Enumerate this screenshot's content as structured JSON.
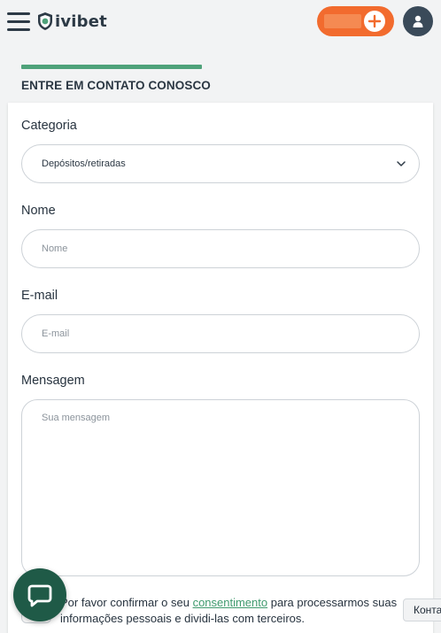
{
  "header": {
    "brand": "ivibet",
    "menu_icon": "hamburger-menu-icon",
    "deposit_icon": "plus-icon",
    "account_icon": "user-icon",
    "accent_color": "#f26b2e"
  },
  "page": {
    "title": "ENTRE EM CONTATO CONOSCO",
    "title_accent_color": "#4fa27a"
  },
  "form": {
    "category": {
      "label": "Categoria",
      "value": "Depósitos/retiradas"
    },
    "name": {
      "label": "Nome",
      "placeholder": "Nome",
      "value": ""
    },
    "email": {
      "label": "E-mail",
      "placeholder": "E-mail",
      "value": ""
    },
    "message": {
      "label": "Mensagem",
      "placeholder": "Sua mensagem",
      "value": ""
    },
    "consent": {
      "prefix": "Por favor confirmar o seu ",
      "link": "consentimento",
      "suffix": " para processarmos suas informações pessoais e dividi-las com terceiros."
    }
  },
  "widgets": {
    "chat_icon": "chat-bubble-icon",
    "chat_color": "#1f5a47",
    "contact_tab": "Контакты"
  }
}
